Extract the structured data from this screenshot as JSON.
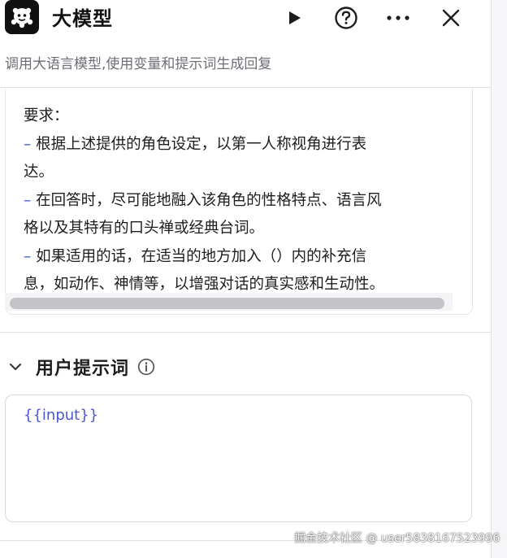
{
  "header": {
    "title": "大模型",
    "subtitle": "调用大语言模型,使用变量和提示词生成回复"
  },
  "system_prompt": {
    "lines": [
      {
        "dash": "",
        "text": "要求："
      },
      {
        "dash": "–",
        "text": " 根据上述提供的角色设定，以第一人称视角进行表"
      },
      {
        "dash": "",
        "text": "达。"
      },
      {
        "dash": "–",
        "text": " 在回答时，尽可能地融入该角色的性格特点、语言风"
      },
      {
        "dash": "",
        "text": "格以及其特有的口头禅或经典台词。"
      },
      {
        "dash": "–",
        "text": " 如果适用的话，在适当的地方加入（）内的补充信"
      },
      {
        "dash": "",
        "text": "息，如动作、神情等，以增强对话的真实感和生动性。"
      }
    ]
  },
  "user_prompt": {
    "section_title": "用户提示词",
    "value": "{{input}}"
  },
  "watermark": "掘金技术社区 @ user5838167523996",
  "icons": {
    "node": "llm-node-icon",
    "run": "play-icon",
    "help": "help-circle-icon",
    "more": "more-horizontal-icon",
    "close": "close-icon",
    "collapse": "chevron-down-icon",
    "info": "info-icon"
  },
  "colors": {
    "accent": "#4a56d6",
    "subtitle": "#6e6e76",
    "border": "#e2e2e6"
  }
}
